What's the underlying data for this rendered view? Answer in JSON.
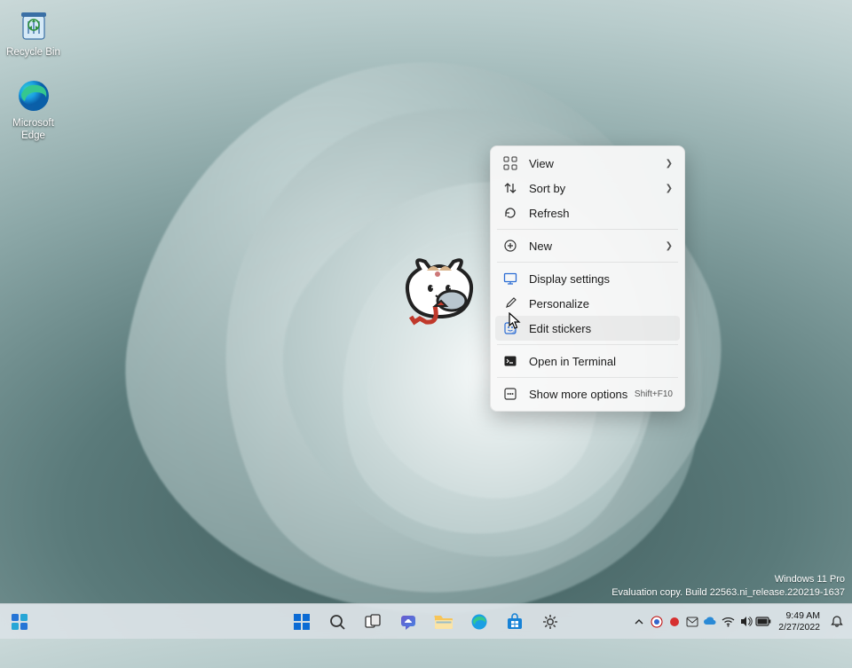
{
  "desktop": {
    "icons": [
      {
        "name": "recycle-bin",
        "label": "Recycle Bin"
      },
      {
        "name": "microsoft-edge",
        "label": "Microsoft Edge"
      }
    ]
  },
  "sticker": {
    "name": "cat-astronaut-sticker"
  },
  "context_menu": {
    "items": [
      {
        "id": "view",
        "label": "View",
        "icon": "grid-icon",
        "submenu": true
      },
      {
        "id": "sort-by",
        "label": "Sort by",
        "icon": "sort-icon",
        "submenu": true
      },
      {
        "id": "refresh",
        "label": "Refresh",
        "icon": "refresh-icon"
      },
      {
        "sep": true
      },
      {
        "id": "new",
        "label": "New",
        "icon": "plus-circle-icon",
        "submenu": true
      },
      {
        "sep": true
      },
      {
        "id": "display-settings",
        "label": "Display settings",
        "icon": "monitor-icon"
      },
      {
        "id": "personalize",
        "label": "Personalize",
        "icon": "paintbrush-icon"
      },
      {
        "id": "edit-stickers",
        "label": "Edit stickers",
        "icon": "sticker-icon",
        "hover": true
      },
      {
        "sep": true
      },
      {
        "id": "open-terminal",
        "label": "Open in Terminal",
        "icon": "terminal-icon"
      },
      {
        "sep": true
      },
      {
        "id": "show-more",
        "label": "Show more options",
        "icon": "more-options-icon",
        "shortcut": "Shift+F10"
      }
    ]
  },
  "watermark": {
    "line1": "Windows 11 Pro",
    "line2": "Evaluation copy. Build 22563.ni_release.220219-1637"
  },
  "taskbar": {
    "center": [
      {
        "name": "start",
        "icon": "start-icon"
      },
      {
        "name": "search",
        "icon": "search-icon"
      },
      {
        "name": "task-view",
        "icon": "taskview-icon"
      },
      {
        "name": "chat",
        "icon": "chat-icon"
      },
      {
        "name": "file-explorer",
        "icon": "explorer-icon"
      },
      {
        "name": "edge",
        "icon": "edge-icon"
      },
      {
        "name": "store",
        "icon": "store-icon"
      },
      {
        "name": "settings",
        "icon": "gear-icon"
      }
    ],
    "systray": {
      "overflow": "chevron-up-icon",
      "icons": [
        "security-icon",
        "record-icon",
        "mail-icon",
        "onedrive-icon",
        "wifi-icon",
        "volume-icon",
        "battery-icon"
      ],
      "clock": {
        "time": "9:49 AM",
        "date": "2/27/2022"
      }
    }
  }
}
